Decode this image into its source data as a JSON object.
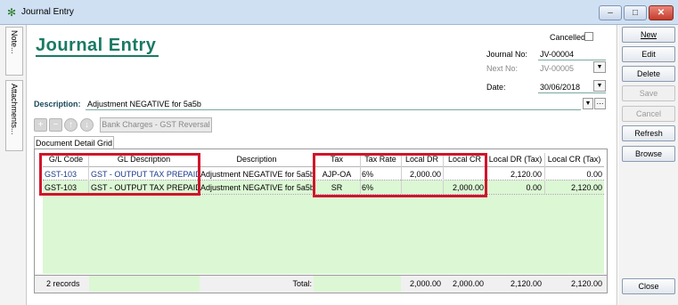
{
  "window": {
    "title": "Journal Entry",
    "min": "–",
    "max": "□",
    "close": "✕"
  },
  "sidebar": {
    "note": "Note...",
    "attachments": "Attachments..."
  },
  "header": {
    "title": "Journal Entry",
    "cancelled_label": "Cancelled",
    "journal_no_label": "Journal No:",
    "journal_no": "JV-00004",
    "next_no_label": "Next No:",
    "next_no": "JV-00005",
    "date_label": "Date:",
    "date": "30/06/2018",
    "description_label": "Description:",
    "description": "Adjustment NEGATIVE for 5a5b"
  },
  "toolbar": {
    "add": "+",
    "remove": "−",
    "up": "↑",
    "down": "↓",
    "bank_charges": "Bank Charges - GST Reversal"
  },
  "grid": {
    "tab": "Document Detail Grid",
    "columns": [
      "G/L Code",
      "GL Description",
      "Description",
      "Tax",
      "Tax Rate",
      "Local DR",
      "Local CR",
      "Local DR (Tax)",
      "Local CR (Tax)"
    ],
    "rows": [
      [
        "GST-103",
        "GST - OUTPUT TAX PREPAID",
        "Adjustment NEGATIVE for 5a5b",
        "AJP-OA",
        "6%",
        "2,000.00",
        "",
        "2,120.00",
        "0.00"
      ],
      [
        "GST-103",
        "GST - OUTPUT TAX PREPAID",
        "Adjustment NEGATIVE for 5a5b",
        "SR",
        "6%",
        "",
        "2,000.00",
        "0.00",
        "2,120.00"
      ]
    ],
    "footer": {
      "records": "2 records",
      "total_label": "Total:",
      "local_dr": "2,000.00",
      "local_cr": "2,000.00",
      "local_dr_tax": "2,120.00",
      "local_cr_tax": "2,120.00"
    }
  },
  "buttons": {
    "new": "New",
    "edit": "Edit",
    "delete": "Delete",
    "save": "Save",
    "cancel": "Cancel",
    "refresh": "Refresh",
    "browse": "Browse",
    "close": "Close"
  },
  "colors": {
    "title_green": "#1a7a64",
    "highlight_red": "#d0152b",
    "row_green": "#dcf7d4"
  }
}
